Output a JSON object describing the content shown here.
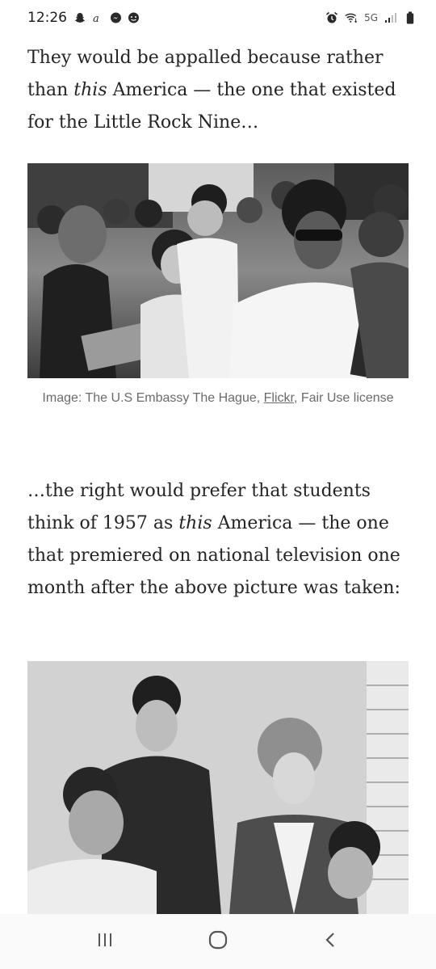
{
  "status_bar": {
    "time": "12:26",
    "network": "5G",
    "left_icons": [
      "snapchat-icon",
      "a-icon",
      "messenger-icon",
      "chat-icon"
    ],
    "right_icons": [
      "alarm-icon",
      "wifi-icon",
      "signal-icon",
      "battery-icon"
    ]
  },
  "article": {
    "paragraph1": {
      "before": "They would be appalled because rather than ",
      "italic": "this",
      "after": " America — the one that existed for the Little Rock Nine…"
    },
    "image1": {
      "caption_before": "Image: The U.S Embassy The Hague, ",
      "caption_link": "Flickr",
      "caption_after": ", Fair Use license"
    },
    "paragraph2": {
      "before": "…the right would prefer that students think of 1957 as ",
      "italic": "this",
      "after": " America — the one that premiered on national television one month after the above picture was taken:"
    }
  },
  "nav_bar": {
    "buttons": [
      "recents-button",
      "home-button",
      "back-button"
    ]
  }
}
